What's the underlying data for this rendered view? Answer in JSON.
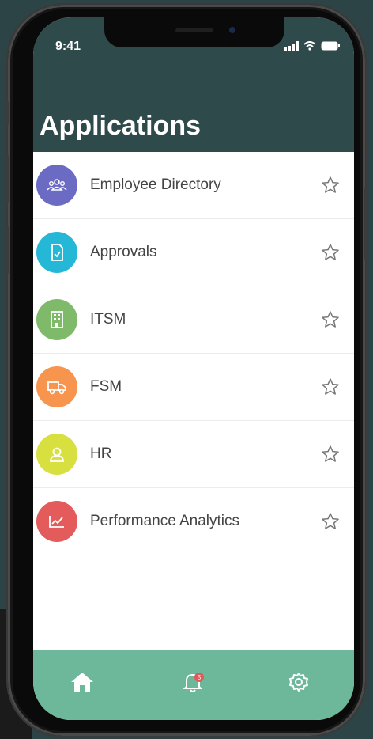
{
  "status_bar": {
    "time": "9:41"
  },
  "header": {
    "title": "Applications"
  },
  "apps": [
    {
      "label": "Employee Directory",
      "icon": "people-icon",
      "color": "#6b6bc4"
    },
    {
      "label": "Approvals",
      "icon": "document-check-icon",
      "color": "#25b8d6"
    },
    {
      "label": "ITSM",
      "icon": "building-icon",
      "color": "#7fba6a"
    },
    {
      "label": "FSM",
      "icon": "truck-icon",
      "color": "#f7954f"
    },
    {
      "label": "HR",
      "icon": "user-icon",
      "color": "#d7e03f"
    },
    {
      "label": "Performance Analytics",
      "icon": "chart-icon",
      "color": "#e35b5b"
    }
  ],
  "tabbar": {
    "items": [
      {
        "icon": "home-icon"
      },
      {
        "icon": "bell-icon",
        "badge": "5"
      },
      {
        "icon": "gear-icon"
      }
    ]
  },
  "colors": {
    "header": "#2f4a4a",
    "tabbar": "#6db89a"
  }
}
